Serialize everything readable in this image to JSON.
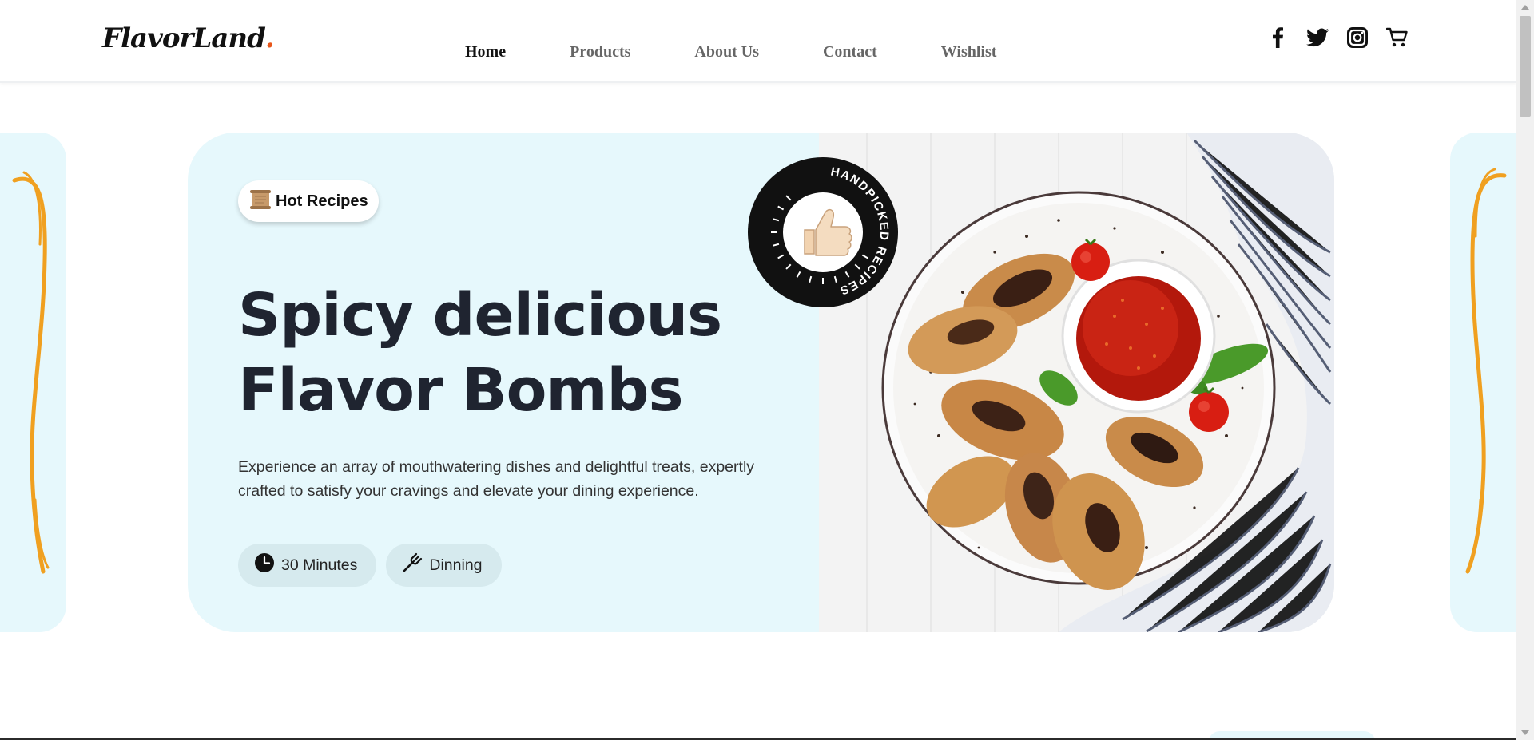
{
  "header": {
    "logo": "FlavorLand",
    "logo_dot": ".",
    "nav": [
      {
        "label": "Home",
        "active": true
      },
      {
        "label": "Products",
        "active": false
      },
      {
        "label": "About Us",
        "active": false
      },
      {
        "label": "Contact",
        "active": false
      },
      {
        "label": "Wishlist",
        "active": false
      }
    ],
    "social_icons": [
      "facebook-icon",
      "twitter-icon",
      "instagram-icon",
      "cart-icon"
    ]
  },
  "hero": {
    "tag": "Hot Recipes",
    "tag_icon": "scroll-icon",
    "title_line1": "Spicy delicious",
    "title_line2": "Flavor Bombs",
    "description": "Experience an array of mouthwatering dishes and delightful treats, expertly crafted to satisfy your cravings and elevate your dining experience.",
    "meta": [
      {
        "icon": "clock-icon",
        "label": "30 Minutes"
      },
      {
        "icon": "fork-knife-icon",
        "label": "Dinning"
      }
    ],
    "badge_text": "HANDPICKED RECIPES",
    "badge_icon": "thumbs-up-icon",
    "image": "grilled chicken wings with tomato salsa on speckled plate"
  },
  "colors": {
    "slide_bg": "#e6f8fc",
    "accent_orange": "#f0a020",
    "logo_dot": "#e8561a",
    "headline": "#1f2430",
    "meta_pill_bg": "#d6eaee"
  }
}
